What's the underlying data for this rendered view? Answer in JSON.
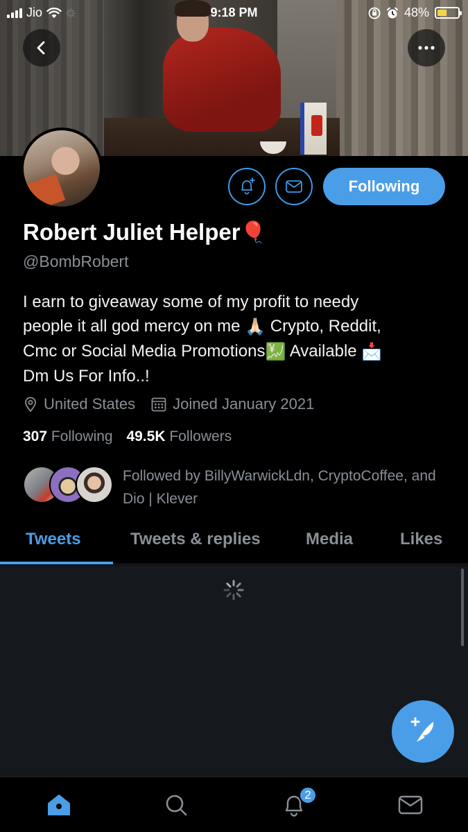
{
  "status_bar": {
    "carrier": "Jio",
    "time": "9:18 PM",
    "battery": "48%",
    "battery_level": 0.48
  },
  "profile": {
    "name": "Robert Juliet Helper",
    "name_emoji": "🎈",
    "handle": "@BombRobert",
    "bio_lines": [
      "I earn to giveaway some of my profit to needy",
      "people it all god mercy on me",
      "Crypto, Reddit,",
      "Cmc or Social Media Promotions",
      "Available",
      "Dm Us For Info..!"
    ],
    "bio_emojis": [
      "🙏🏻",
      "💹",
      "📩"
    ],
    "location": "United States",
    "joined": "Joined January 2021",
    "following_count": "307",
    "following_label": "Following",
    "followers_count": "49.5K",
    "followers_label": "Followers",
    "followed_by": "Followed by BillyWarwickLdn, CryptoCoffee, and Dio | Klever"
  },
  "actions": {
    "follow_label": "Following"
  },
  "tabs": [
    {
      "label": "Tweets",
      "active": true
    },
    {
      "label": "Tweets & replies",
      "active": false
    },
    {
      "label": "Media",
      "active": false
    },
    {
      "label": "Likes",
      "active": false
    }
  ],
  "bottom_nav": {
    "notifications_badge": "2"
  },
  "colors": {
    "accent": "#4a9ee8",
    "muted": "#8a8f96",
    "background": "#000000"
  }
}
